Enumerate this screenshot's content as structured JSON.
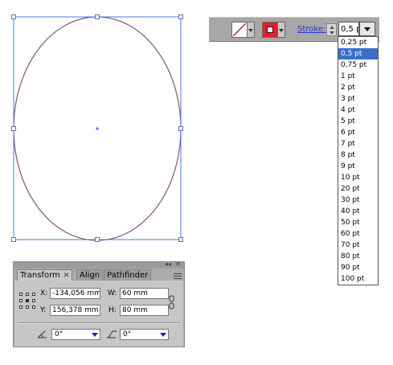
{
  "control_bar": {
    "stroke_label": "Stroke:",
    "stroke_weight_value": "0,5 pt"
  },
  "weight_dropdown": {
    "options": [
      "0,25 pt",
      "0,5 pt",
      "0,75 pt",
      "1 pt",
      "2 pt",
      "3 pt",
      "4 pt",
      "5 pt",
      "6 pt",
      "7 pt",
      "8 pt",
      "9 pt",
      "10 pt",
      "20 pt",
      "30 pt",
      "40 pt",
      "50 pt",
      "60 pt",
      "70 pt",
      "80 pt",
      "90 pt",
      "100 pt"
    ],
    "selected": "0,5 pt"
  },
  "transform_panel": {
    "tabs": [
      "Transform",
      "Align",
      "Pathfinder"
    ],
    "active_tab": "Transform",
    "x_label": "X:",
    "x_value": "-134,056 mm",
    "y_label": "Y:",
    "y_value": "156,378 mm",
    "w_label": "W:",
    "w_value": "60 mm",
    "h_label": "H:",
    "h_value": "80 mm",
    "rotate_value": "0°",
    "shear_value": "0°"
  },
  "colors": {
    "selection_blue": "#4a78d8",
    "path_stroke": "#c0392b",
    "selected_item_bg": "#3a6ec8"
  }
}
